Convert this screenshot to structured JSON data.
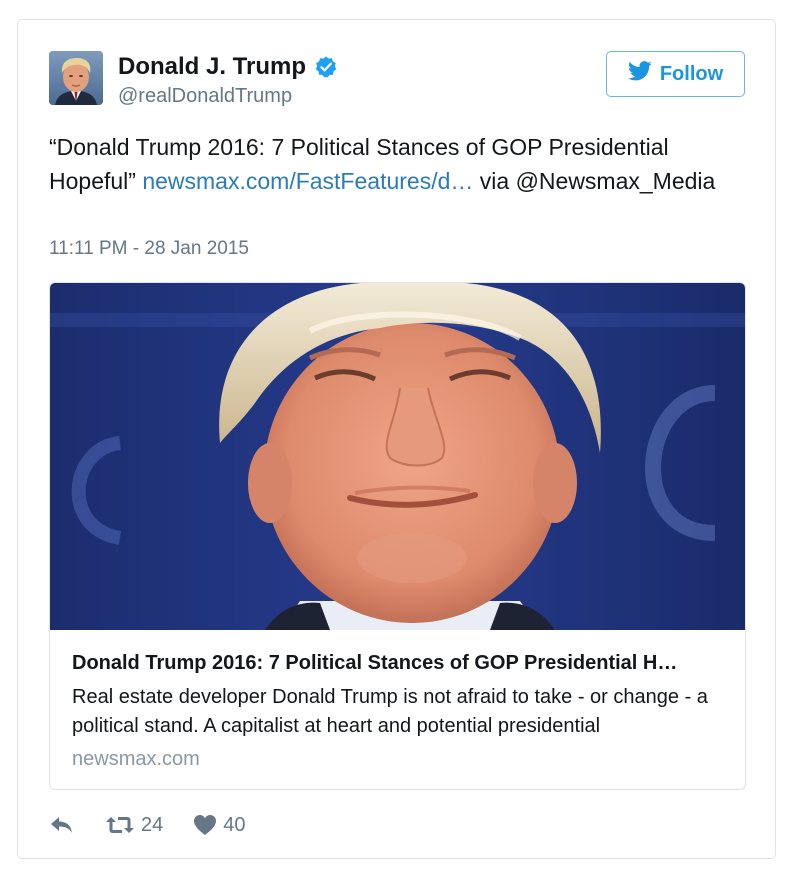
{
  "user": {
    "display_name": "Donald J. Trump",
    "handle": "@realDonaldTrump",
    "verified": true
  },
  "follow_button": {
    "label": "Follow"
  },
  "tweet": {
    "text_before_link": "“Donald Trump 2016: 7 Political Stances of GOP Presidential Hopeful” ",
    "link_text": "newsmax.com/FastFeatures/d…",
    "text_after_link": " via @Newsmax_Media",
    "timestamp": "11:11 PM - 28 Jan 2015"
  },
  "card": {
    "title": "Donald Trump 2016: 7 Political Stances of GOP Presidential H…",
    "description": "Real estate developer Donald Trump is not afraid to take - or change - a political stand. A capitalist at heart and potential presidential",
    "domain": "newsmax.com"
  },
  "actions": {
    "retweet_count": "24",
    "like_count": "40"
  },
  "colors": {
    "link": "#2b7bb9",
    "follow_blue": "#1b95e0",
    "verified_blue": "#1da1f2",
    "secondary_text": "#657786"
  },
  "icons": {
    "reply": "reply-icon",
    "retweet": "retweet-icon",
    "like": "heart-icon",
    "verified": "verified-badge-icon",
    "follow": "twitter-bird-icon"
  }
}
